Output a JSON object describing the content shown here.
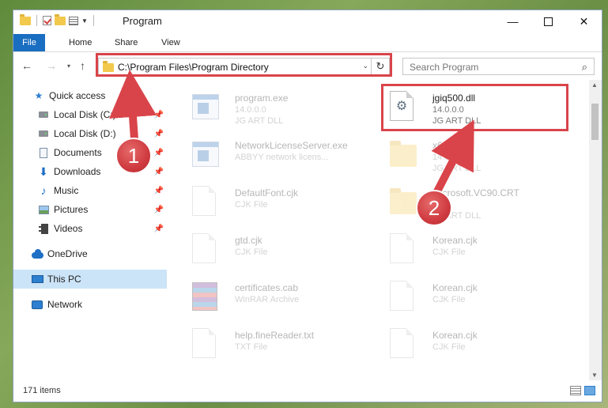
{
  "window": {
    "title": "Program",
    "controls": {
      "minimize": "—",
      "close": "✕"
    }
  },
  "ribbon": {
    "tabs": [
      {
        "label": "File",
        "active": true
      },
      {
        "label": "Home"
      },
      {
        "label": "Share"
      },
      {
        "label": "View"
      }
    ]
  },
  "navigation": {
    "back": "←",
    "forward": "→",
    "recent": "▾",
    "up": "↑",
    "address": "C:\\Program Files\\Program Directory",
    "address_dropdown": "⌄",
    "refresh": "↻",
    "search_placeholder": "Search Program",
    "search_icon": "⌕"
  },
  "sidebar": {
    "items": [
      {
        "label": "Quick access",
        "icon": "star-icon",
        "pinned": false
      },
      {
        "label": "Local Disk (C:)",
        "icon": "disk-icon",
        "pinned": true
      },
      {
        "label": "Local Disk (D:)",
        "icon": "disk-icon",
        "pinned": true
      },
      {
        "label": "Documents",
        "icon": "document-icon",
        "pinned": true
      },
      {
        "label": "Downloads",
        "icon": "download-icon",
        "pinned": true
      },
      {
        "label": "Music",
        "icon": "music-icon",
        "pinned": true
      },
      {
        "label": "Pictures",
        "icon": "pictures-icon",
        "pinned": true
      },
      {
        "label": "Videos",
        "icon": "video-icon",
        "pinned": true
      },
      {
        "label": "OneDrive",
        "icon": "cloud-icon",
        "pinned": false
      },
      {
        "label": "This PC",
        "icon": "computer-icon",
        "selected": true
      },
      {
        "label": "Network",
        "icon": "network-icon"
      }
    ],
    "pin_glyph": "📌"
  },
  "files": [
    {
      "name": "program.exe",
      "line2": "14.0.0.0",
      "line3": "JG ART DLL",
      "icon": "application-icon"
    },
    {
      "name": "jgiq500.dll",
      "line2": "14.0.0.0",
      "line3": "JG ART DLL",
      "icon": "dll-gear-icon",
      "highlighted": true
    },
    {
      "name": "NetworkLicenseServer.exe",
      "line2": "ABBYY network licens...",
      "line3": "",
      "icon": "application-icon"
    },
    {
      "name": "x64",
      "line2": "14.0.0.0",
      "line3": "JG ART DLL",
      "icon": "folder-icon"
    },
    {
      "name": "DefaultFont.cjk",
      "line2": "CJK File",
      "line3": "",
      "icon": "file-icon"
    },
    {
      "name": "Microsoft.VC90.CRT",
      "line2": "",
      "line3": "JG ART DLL",
      "icon": "folder-icon"
    },
    {
      "name": "gtd.cjk",
      "line2": "CJK File",
      "line3": "",
      "icon": "file-icon"
    },
    {
      "name": "Korean.cjk",
      "line2": "CJK File",
      "line3": "",
      "icon": "file-icon"
    },
    {
      "name": "certificates.cab",
      "line2": "WinRAR Archive",
      "line3": "",
      "icon": "winrar-icon"
    },
    {
      "name": "Korean.cjk",
      "line2": "CJK File",
      "line3": "",
      "icon": "file-icon"
    },
    {
      "name": "help.fineReader.txt",
      "line2": "TXT File",
      "line3": "",
      "icon": "file-icon"
    },
    {
      "name": "Korean.cjk",
      "line2": "CJK File",
      "line3": "",
      "icon": "file-icon"
    }
  ],
  "status": {
    "count": "171 items"
  },
  "annotations": [
    {
      "number": "1",
      "target": "address-bar"
    },
    {
      "number": "2",
      "target": "jgiq500.dll"
    }
  ],
  "colors": {
    "accent": "#1a6ec1",
    "highlight": "#d9444a",
    "selection": "#cce4f7"
  }
}
